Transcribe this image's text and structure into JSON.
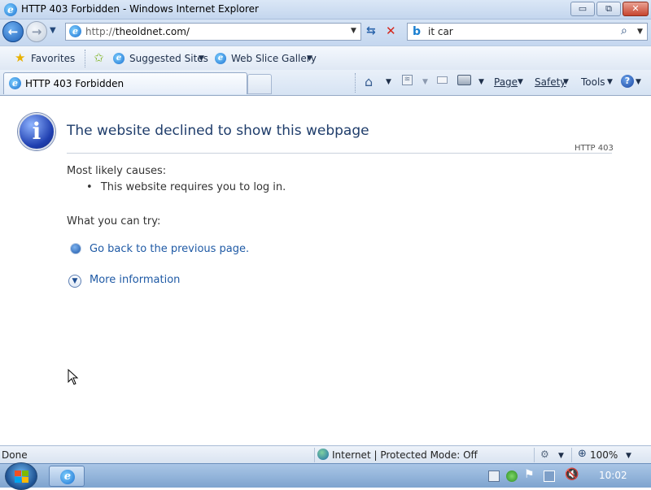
{
  "window": {
    "title": "HTTP 403 Forbidden - Windows Internet Explorer",
    "minimize": "▭",
    "maximize": "⧉",
    "close": "✕"
  },
  "address_bar": {
    "url_prefix": "http://",
    "url_host": "theoldnet.com/",
    "search_value": "it car"
  },
  "favorites_bar": {
    "favorites_label": "Favorites",
    "suggested_sites": "Suggested Sites",
    "web_slice_gallery": "Web Slice Gallery"
  },
  "tabs": [
    {
      "label": "HTTP 403 Forbidden",
      "active": true
    }
  ],
  "command_bar": {
    "page": "Page",
    "safety": "Safety",
    "tools": "Tools"
  },
  "page": {
    "title": "The website declined to show this webpage",
    "code": "HTTP 403",
    "causes_heading": "Most likely causes:",
    "causes": [
      "This website requires you to log in."
    ],
    "try_heading": "What you can try:",
    "go_back_link": "Go back to the previous page.",
    "more_info_link": "More information"
  },
  "status_bar": {
    "status": "Done",
    "zone": "Internet | Protected Mode: Off",
    "zoom": "100%"
  },
  "taskbar": {
    "clock": "10:02"
  },
  "colors": {
    "title_blue": "#1f3d6b",
    "link_blue": "#1f5aa5",
    "chrome_blue": "#c5d7ef"
  }
}
